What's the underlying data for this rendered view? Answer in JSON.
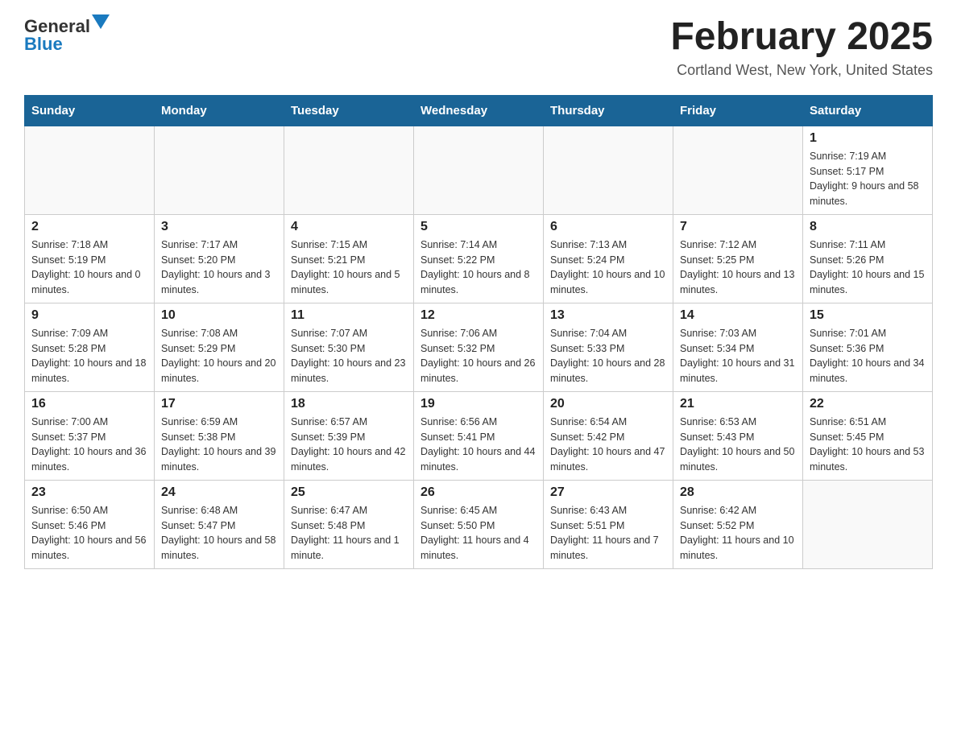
{
  "logo": {
    "part1": "General",
    "part2": "Blue"
  },
  "title": "February 2025",
  "subtitle": "Cortland West, New York, United States",
  "weekdays": [
    "Sunday",
    "Monday",
    "Tuesday",
    "Wednesday",
    "Thursday",
    "Friday",
    "Saturday"
  ],
  "weeks": [
    [
      {
        "day": "",
        "info": ""
      },
      {
        "day": "",
        "info": ""
      },
      {
        "day": "",
        "info": ""
      },
      {
        "day": "",
        "info": ""
      },
      {
        "day": "",
        "info": ""
      },
      {
        "day": "",
        "info": ""
      },
      {
        "day": "1",
        "info": "Sunrise: 7:19 AM\nSunset: 5:17 PM\nDaylight: 9 hours and 58 minutes."
      }
    ],
    [
      {
        "day": "2",
        "info": "Sunrise: 7:18 AM\nSunset: 5:19 PM\nDaylight: 10 hours and 0 minutes."
      },
      {
        "day": "3",
        "info": "Sunrise: 7:17 AM\nSunset: 5:20 PM\nDaylight: 10 hours and 3 minutes."
      },
      {
        "day": "4",
        "info": "Sunrise: 7:15 AM\nSunset: 5:21 PM\nDaylight: 10 hours and 5 minutes."
      },
      {
        "day": "5",
        "info": "Sunrise: 7:14 AM\nSunset: 5:22 PM\nDaylight: 10 hours and 8 minutes."
      },
      {
        "day": "6",
        "info": "Sunrise: 7:13 AM\nSunset: 5:24 PM\nDaylight: 10 hours and 10 minutes."
      },
      {
        "day": "7",
        "info": "Sunrise: 7:12 AM\nSunset: 5:25 PM\nDaylight: 10 hours and 13 minutes."
      },
      {
        "day": "8",
        "info": "Sunrise: 7:11 AM\nSunset: 5:26 PM\nDaylight: 10 hours and 15 minutes."
      }
    ],
    [
      {
        "day": "9",
        "info": "Sunrise: 7:09 AM\nSunset: 5:28 PM\nDaylight: 10 hours and 18 minutes."
      },
      {
        "day": "10",
        "info": "Sunrise: 7:08 AM\nSunset: 5:29 PM\nDaylight: 10 hours and 20 minutes."
      },
      {
        "day": "11",
        "info": "Sunrise: 7:07 AM\nSunset: 5:30 PM\nDaylight: 10 hours and 23 minutes."
      },
      {
        "day": "12",
        "info": "Sunrise: 7:06 AM\nSunset: 5:32 PM\nDaylight: 10 hours and 26 minutes."
      },
      {
        "day": "13",
        "info": "Sunrise: 7:04 AM\nSunset: 5:33 PM\nDaylight: 10 hours and 28 minutes."
      },
      {
        "day": "14",
        "info": "Sunrise: 7:03 AM\nSunset: 5:34 PM\nDaylight: 10 hours and 31 minutes."
      },
      {
        "day": "15",
        "info": "Sunrise: 7:01 AM\nSunset: 5:36 PM\nDaylight: 10 hours and 34 minutes."
      }
    ],
    [
      {
        "day": "16",
        "info": "Sunrise: 7:00 AM\nSunset: 5:37 PM\nDaylight: 10 hours and 36 minutes."
      },
      {
        "day": "17",
        "info": "Sunrise: 6:59 AM\nSunset: 5:38 PM\nDaylight: 10 hours and 39 minutes."
      },
      {
        "day": "18",
        "info": "Sunrise: 6:57 AM\nSunset: 5:39 PM\nDaylight: 10 hours and 42 minutes."
      },
      {
        "day": "19",
        "info": "Sunrise: 6:56 AM\nSunset: 5:41 PM\nDaylight: 10 hours and 44 minutes."
      },
      {
        "day": "20",
        "info": "Sunrise: 6:54 AM\nSunset: 5:42 PM\nDaylight: 10 hours and 47 minutes."
      },
      {
        "day": "21",
        "info": "Sunrise: 6:53 AM\nSunset: 5:43 PM\nDaylight: 10 hours and 50 minutes."
      },
      {
        "day": "22",
        "info": "Sunrise: 6:51 AM\nSunset: 5:45 PM\nDaylight: 10 hours and 53 minutes."
      }
    ],
    [
      {
        "day": "23",
        "info": "Sunrise: 6:50 AM\nSunset: 5:46 PM\nDaylight: 10 hours and 56 minutes."
      },
      {
        "day": "24",
        "info": "Sunrise: 6:48 AM\nSunset: 5:47 PM\nDaylight: 10 hours and 58 minutes."
      },
      {
        "day": "25",
        "info": "Sunrise: 6:47 AM\nSunset: 5:48 PM\nDaylight: 11 hours and 1 minute."
      },
      {
        "day": "26",
        "info": "Sunrise: 6:45 AM\nSunset: 5:50 PM\nDaylight: 11 hours and 4 minutes."
      },
      {
        "day": "27",
        "info": "Sunrise: 6:43 AM\nSunset: 5:51 PM\nDaylight: 11 hours and 7 minutes."
      },
      {
        "day": "28",
        "info": "Sunrise: 6:42 AM\nSunset: 5:52 PM\nDaylight: 11 hours and 10 minutes."
      },
      {
        "day": "",
        "info": ""
      }
    ]
  ]
}
